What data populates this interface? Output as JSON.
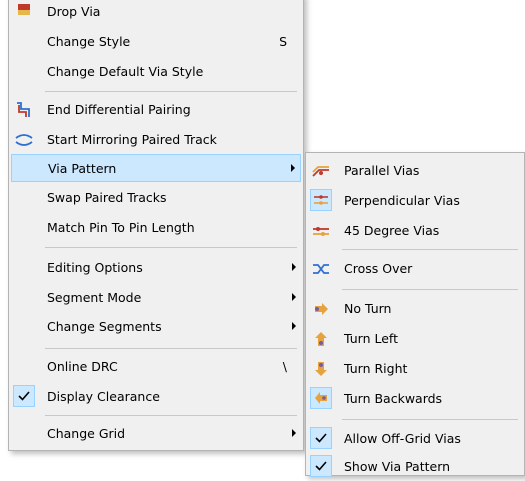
{
  "main_menu": {
    "items": [
      {
        "label": "Drop Via",
        "icon": "drop-via-icon"
      },
      {
        "label": "Change Style",
        "shortcut": "S"
      },
      {
        "label": "Change Default Via Style"
      },
      {
        "label": "End Differential Pairing",
        "icon": "end-differential-pairing-icon"
      },
      {
        "label": "Start Mirroring Paired Track",
        "icon": "mirroring-paired-track-icon"
      },
      {
        "label": "Via Pattern",
        "submenu": true,
        "highlighted": true
      },
      {
        "label": "Swap Paired Tracks"
      },
      {
        "label": "Match Pin To Pin Length"
      },
      {
        "label": "Editing Options",
        "submenu": true
      },
      {
        "label": "Segment Mode",
        "submenu": true
      },
      {
        "label": "Change Segments",
        "submenu": true
      },
      {
        "label": "Online DRC",
        "shortcut": "\\"
      },
      {
        "label": "Display Clearance",
        "checked": true
      },
      {
        "label": "Change Grid",
        "submenu": true
      }
    ]
  },
  "via_pattern_submenu": {
    "items": [
      {
        "label": "Parallel Vias",
        "icon": "parallel-vias-icon"
      },
      {
        "label": "Perpendicular Vias",
        "icon": "perpendicular-vias-icon",
        "selected": true
      },
      {
        "label": "45 Degree Vias",
        "icon": "45-degree-vias-icon"
      },
      {
        "label": "Cross Over",
        "icon": "cross-over-icon"
      },
      {
        "label": "No Turn",
        "icon": "no-turn-icon"
      },
      {
        "label": "Turn Left",
        "icon": "turn-left-icon"
      },
      {
        "label": "Turn Right",
        "icon": "turn-right-icon"
      },
      {
        "label": "Turn Backwards",
        "icon": "turn-backwards-icon",
        "selected": true
      },
      {
        "label": "Allow Off-Grid Vias",
        "checked": true
      },
      {
        "label": "Show Via Pattern",
        "checked": true
      }
    ]
  },
  "colors": {
    "highlight": "#cce8ff",
    "highlight_border": "#99d1ff",
    "menu_background": "#f0f0f0"
  }
}
